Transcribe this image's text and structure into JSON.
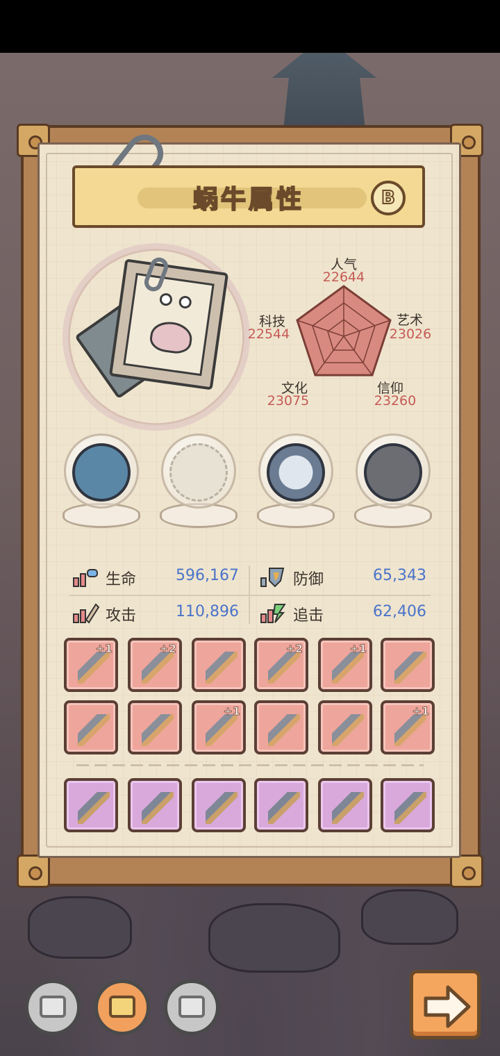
{
  "panel": {
    "title": "蜗牛属性",
    "badge": "B"
  },
  "radar": {
    "popularity": {
      "label": "人气",
      "value": "22644"
    },
    "art": {
      "label": "艺术",
      "value": "23026"
    },
    "faith": {
      "label": "信仰",
      "value": "23260"
    },
    "culture": {
      "label": "文化",
      "value": "23075"
    },
    "tech": {
      "label": "科技",
      "value": "22544"
    }
  },
  "relics": [
    {
      "name": "monster-relic-icon"
    },
    {
      "name": "empty-shell-slot-icon"
    },
    {
      "name": "compass-relic-icon"
    },
    {
      "name": "meteor-relic-icon"
    }
  ],
  "stats": {
    "hp": {
      "label": "生命",
      "value": "596,167"
    },
    "def": {
      "label": "防御",
      "value": "65,343"
    },
    "atk": {
      "label": "攻击",
      "value": "110,896"
    },
    "chase": {
      "label": "追击",
      "value": "62,406"
    }
  },
  "equipment_pink": [
    {
      "icon": "dagger-icon",
      "plus": "+1"
    },
    {
      "icon": "sword-icon",
      "plus": "+2"
    },
    {
      "icon": "crossbow-icon",
      "plus": ""
    },
    {
      "icon": "rocket-sword-icon",
      "plus": "+2"
    },
    {
      "icon": "serpent-staff-icon",
      "plus": "+1"
    },
    {
      "icon": "hammer-icon",
      "plus": ""
    },
    {
      "icon": "longsword-icon",
      "plus": ""
    },
    {
      "icon": "axe-icon",
      "plus": ""
    },
    {
      "icon": "helmet-icon",
      "plus": "+1"
    },
    {
      "icon": "belt-icon",
      "plus": ""
    },
    {
      "icon": "glove-icon",
      "plus": ""
    },
    {
      "icon": "drum-icon",
      "plus": "+1"
    }
  ],
  "equipment_purple": [
    {
      "icon": "mace-icon"
    },
    {
      "icon": "chest-icon"
    },
    {
      "icon": "scroll-icon"
    },
    {
      "icon": "spear-icon"
    },
    {
      "icon": "katana-icon"
    },
    {
      "icon": "gauntlet-icon"
    }
  ],
  "colors": {
    "stat_value": "#4a73c9",
    "radar_value": "#c55a55",
    "radar_fill": "#d98a80"
  }
}
